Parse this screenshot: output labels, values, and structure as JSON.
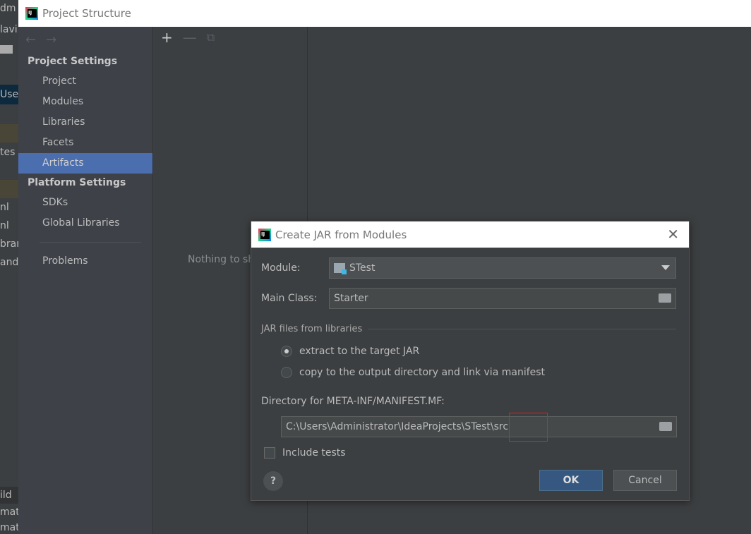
{
  "background_ide": {
    "fragments": [
      "dm",
      "lavi",
      "Users",
      "tes",
      "nl",
      "nl",
      "brar",
      "and",
      "ild",
      "mati",
      "mati"
    ]
  },
  "window": {
    "title": "Project Structure"
  },
  "sidebar": {
    "sections": [
      {
        "title": "Project Settings",
        "items": [
          "Project",
          "Modules",
          "Libraries",
          "Facets",
          "Artifacts"
        ]
      },
      {
        "title": "Platform Settings",
        "items": [
          "SDKs",
          "Global Libraries"
        ]
      }
    ],
    "problems": "Problems",
    "selected": "Artifacts"
  },
  "middle": {
    "empty_text": "Nothing to show"
  },
  "dialog": {
    "title": "Create JAR from Modules",
    "module_label": "Module:",
    "module_value": "STest",
    "main_class_label": "Main Class:",
    "main_class_value": "Starter",
    "group_label": "JAR files from libraries",
    "radio_extract": "extract to the target JAR",
    "radio_copy": "copy to the output directory and link via manifest",
    "radio_selected": "extract",
    "dir_label": "Directory for META-INF/MANIFEST.MF:",
    "dir_value": "C:\\Users\\Administrator\\IdeaProjects\\STest\\src",
    "include_tests": "Include tests",
    "include_tests_checked": false,
    "help": "?",
    "ok": "OK",
    "cancel": "Cancel"
  },
  "colors": {
    "selection": "#4b6eaf",
    "ok_button": "#365880",
    "annotation": "#e02020"
  }
}
